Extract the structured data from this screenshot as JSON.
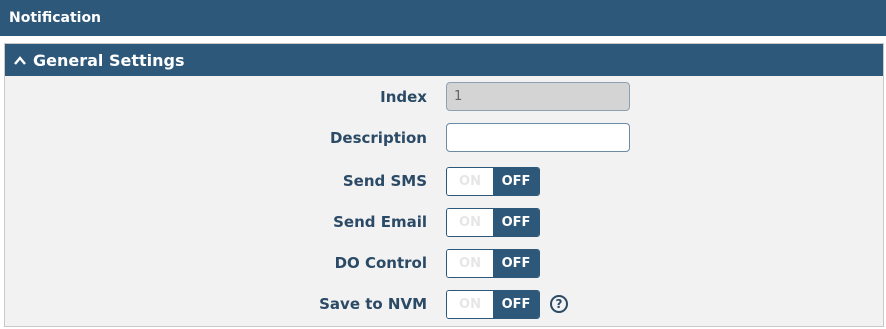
{
  "top_bar": {
    "title": "Notification"
  },
  "panel": {
    "title": "General Settings"
  },
  "fields": {
    "index": {
      "label": "Index",
      "value": "1"
    },
    "description": {
      "label": "Description",
      "value": ""
    },
    "send_sms": {
      "label": "Send SMS",
      "on": "ON",
      "off": "OFF",
      "state": "OFF"
    },
    "send_email": {
      "label": "Send Email",
      "on": "ON",
      "off": "OFF",
      "state": "OFF"
    },
    "do_control": {
      "label": "DO Control",
      "on": "ON",
      "off": "OFF",
      "state": "OFF"
    },
    "save_to_nvm": {
      "label": "Save to NVM",
      "on": "ON",
      "off": "OFF",
      "state": "OFF",
      "help": "?"
    }
  },
  "colors": {
    "header": "#2d5879",
    "label": "#2b4a66",
    "panel_bg": "#f2f2f2"
  },
  "icons": {
    "collapse": "chevron-up-icon",
    "help": "help-icon"
  }
}
